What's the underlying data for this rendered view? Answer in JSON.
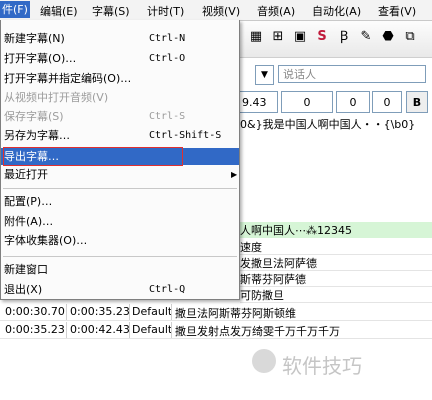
{
  "menubar": {
    "file": "件(F)",
    "edit": "编辑(E)",
    "subtitles": "字幕(S)",
    "timing": "计时(T)",
    "video": "视频(V)",
    "audio": "音频(A)",
    "automation": "自动化(A)",
    "view": "查看(V)"
  },
  "file_menu": {
    "new": {
      "label": "新建字幕(N)",
      "shortcut": "Ctrl-N"
    },
    "open": {
      "label": "打开字幕(O)…",
      "shortcut": "Ctrl-O"
    },
    "open_charset": {
      "label": "打开字幕并指定编码(O)…"
    },
    "open_from_video": {
      "label": "从视频中打开音频(V)"
    },
    "save": {
      "label": "保存字幕(S)",
      "shortcut": "Ctrl-S"
    },
    "save_as": {
      "label": "另存为字幕…",
      "shortcut": "Ctrl-Shift-S"
    },
    "export": {
      "label": "导出字幕…"
    },
    "recent": {
      "label": "最近打开"
    },
    "config": {
      "label": "配置(P)…"
    },
    "attachments": {
      "label": "附件(A)…"
    },
    "font_collector": {
      "label": "字体收集器(O)…"
    },
    "new_window": {
      "label": "新建窗口"
    },
    "exit": {
      "label": "退出(X)",
      "shortcut": "Ctrl-Q"
    }
  },
  "editor": {
    "speaker_placeholder": "说话人",
    "time_fragment": "9.43",
    "layer": "0",
    "margin_l": "0",
    "margin_r": "0",
    "bold": "B",
    "text_line": "0&}我是中国人啊中国人・・{\\b0}",
    "grid_partial": [
      "人啊中国人⋯⁂12345",
      "速度",
      "发撒旦法阿萨德",
      "斯蒂芬阿萨德",
      "可防撒旦",
      "撒旦法阿斯蒂芬阿斯顿维"
    ]
  },
  "grid": {
    "rows": [
      {
        "start": "0:00:30.70",
        "end": "0:00:35.23",
        "style": "Default",
        "text": "撒旦法阿斯蒂芬阿斯顿维"
      },
      {
        "start": "0:00:35.23",
        "end": "0:00:42.43",
        "style": "Default",
        "text": "撒旦发射点发万绮雯千万千万千万"
      }
    ]
  },
  "watermark": "软件技巧"
}
